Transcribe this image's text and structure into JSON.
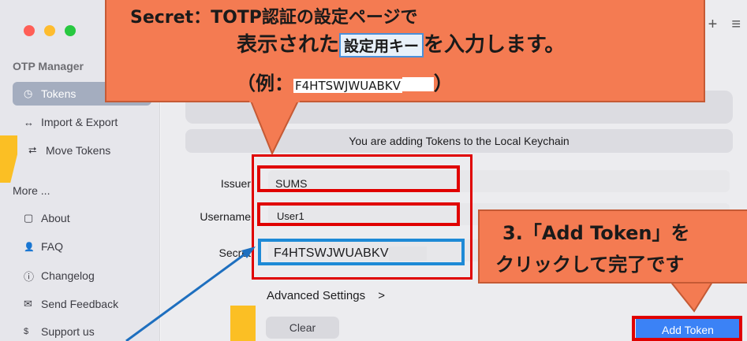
{
  "app": {
    "title": "OTP Manager"
  },
  "sidebar": {
    "items": [
      {
        "label": "Tokens",
        "icon": "clock-icon",
        "glyph": "◷"
      },
      {
        "label": "Import & Export",
        "icon": "arrows-horizontal-icon",
        "glyph": "↔"
      },
      {
        "label": "Move Tokens",
        "icon": "move-icon",
        "glyph": "⮂"
      }
    ],
    "more_title": "More ...",
    "more_items": [
      {
        "label": "About",
        "icon": "sidebar-panel-icon",
        "glyph": "▢"
      },
      {
        "label": "FAQ",
        "icon": "person-question-icon",
        "glyph": "👤"
      },
      {
        "label": "Changelog",
        "icon": "info-icon",
        "glyph": "ⓘ"
      },
      {
        "label": "Send Feedback",
        "icon": "envelope-icon",
        "glyph": "✉"
      },
      {
        "label": "Support us",
        "icon": "dollar-circle-icon",
        "glyph": "$"
      }
    ]
  },
  "toolbar": {
    "add_glyph": "+",
    "filter_glyph": "≡"
  },
  "banner": "You are adding Tokens to the Local Keychain",
  "form": {
    "issuer_label": "Issuer",
    "issuer_value": "SUMS",
    "username_label": "Username",
    "username_value": "User1",
    "secret_label": "Secret",
    "secret_value": "F4HTSWJWUABKV"
  },
  "advanced": {
    "label": "Advanced Settings",
    "chevron": ">"
  },
  "buttons": {
    "clear": "Clear",
    "add": "Add Token"
  },
  "annotations": {
    "secret_line1": "Secret：TOTP認証の設定ページで",
    "secret_line2_pre": "表示された",
    "secret_line2_key": "設定用キー",
    "secret_line2_post": "を入力します。",
    "secret_line3_pre": "（例：",
    "secret_line3_example": "F4HTSWJWUABKV",
    "secret_line3_post": "）",
    "add_line1": "3.「Add Token」を",
    "add_line2": "クリックして完了です"
  },
  "colors": {
    "callout": "#f47b52",
    "highlight_red": "#e00000",
    "highlight_blue": "#1e8ad6",
    "accent_button": "#3b82f6",
    "sidebar_active": "#a4adbf"
  }
}
